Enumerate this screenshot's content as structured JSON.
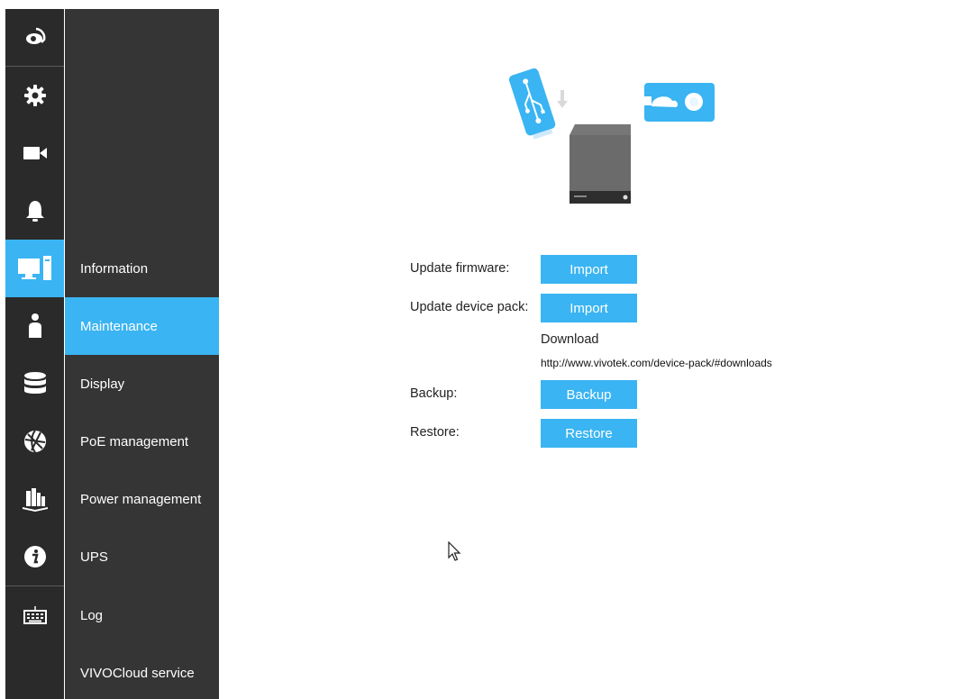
{
  "rail": {
    "items": [
      {
        "icon": "camera-live-view-icon"
      },
      {
        "icon": "gear-icon"
      },
      {
        "icon": "video-camera-icon"
      },
      {
        "icon": "bell-icon"
      },
      {
        "icon": "monitor-system-icon",
        "active": true
      },
      {
        "icon": "person-icon"
      },
      {
        "icon": "database-icon"
      },
      {
        "icon": "network-globe-icon"
      },
      {
        "icon": "security-icon"
      },
      {
        "icon": "info-icon"
      },
      {
        "icon": "keyboard-icon"
      }
    ]
  },
  "submenu": {
    "items": [
      {
        "label": "Information"
      },
      {
        "label": "Maintenance",
        "active": true
      },
      {
        "label": "Display"
      },
      {
        "label": "PoE management"
      },
      {
        "label": "Power management"
      },
      {
        "label": "UPS"
      },
      {
        "label": "Log"
      },
      {
        "label": "VIVOCloud service"
      }
    ]
  },
  "maintenance": {
    "firmware": {
      "label": "Update firmware:",
      "button": "Import"
    },
    "device_pack": {
      "label": "Update device pack:",
      "button": "Import"
    },
    "download": {
      "title": "Download",
      "link": "http://www.vivotek.com/device-pack/#downloads"
    },
    "backup": {
      "label": "Backup:",
      "button": "Backup"
    },
    "restore": {
      "label": "Restore:",
      "button": "Restore"
    }
  },
  "colors": {
    "accent": "#3ab4f2",
    "rail_bg": "#2a2a2a",
    "submenu_bg": "#353535",
    "text": "#222222"
  }
}
